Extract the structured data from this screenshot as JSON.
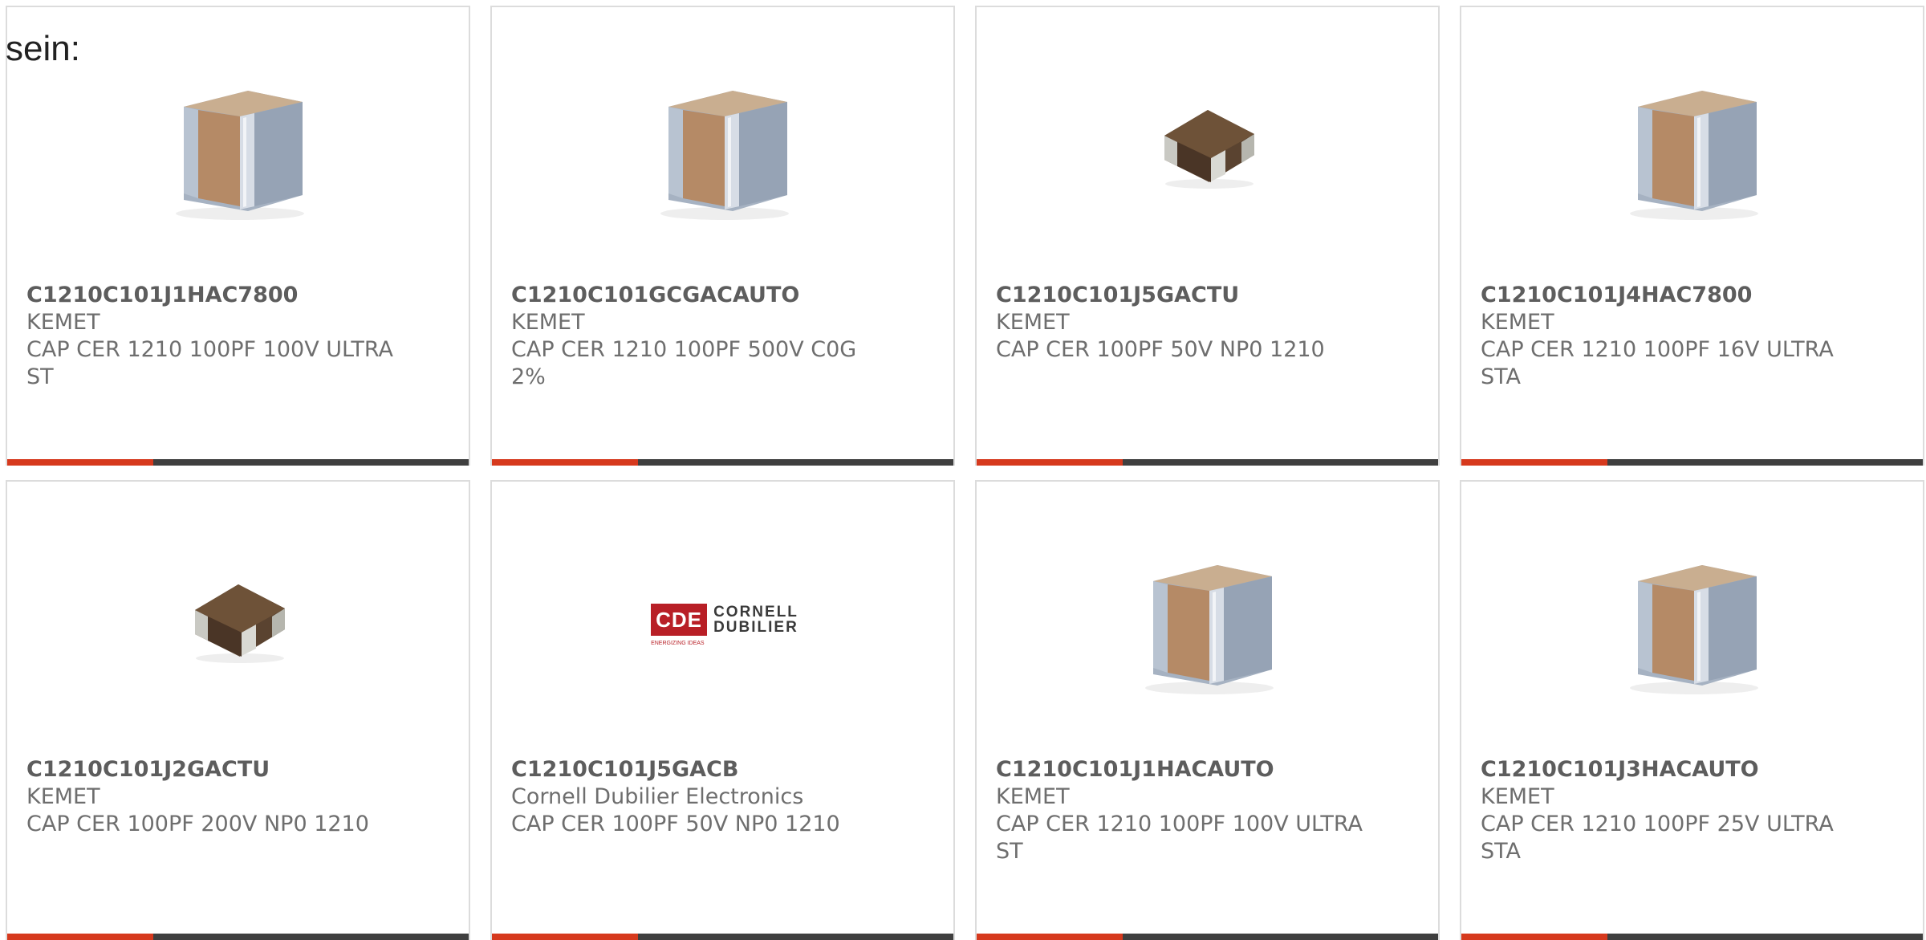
{
  "page": {
    "heading": "sein:"
  },
  "colors": {
    "accent_bar": "#d6391d",
    "dark_bar": "#3f3f3f",
    "card_border": "#dcdcdc",
    "body_text": "#6e6e6e",
    "ceramic": "#b58a66",
    "terminal": "#a6b2c2",
    "logo_red": "#b81f26"
  },
  "products": [
    {
      "part_number": "C1210C101J1HAC7800",
      "manufacturer": "KEMET",
      "description": "CAP CER 1210 100PF 100V ULTRA ST",
      "image": "mlcc-capacitor-large-icon"
    },
    {
      "part_number": "C1210C101GCGACAUTO",
      "manufacturer": "KEMET",
      "description": "CAP CER 1210 100PF 500V C0G 2%",
      "image": "mlcc-capacitor-large-icon"
    },
    {
      "part_number": "C1210C101J5GACTU",
      "manufacturer": "KEMET",
      "description": "CAP CER 100PF 50V NP0 1210",
      "image": "mlcc-capacitor-small-icon"
    },
    {
      "part_number": "C1210C101J4HAC7800",
      "manufacturer": "KEMET",
      "description": "CAP CER 1210 100PF 16V ULTRA STA",
      "image": "mlcc-capacitor-large-icon"
    },
    {
      "part_number": "C1210C101J2GACTU",
      "manufacturer": "KEMET",
      "description": "CAP CER 100PF 200V NP0 1210",
      "image": "mlcc-capacitor-small-icon"
    },
    {
      "part_number": "C1210C101J5GACB",
      "manufacturer": "Cornell Dubilier Electronics",
      "description": "CAP CER 100PF 50V NP0 1210",
      "image": "cde-logo",
      "logo_box_text": "CDE",
      "logo_line1": "CORNELL",
      "logo_line2": "DUBILIER",
      "logo_tag": "ENERGIZING IDEAS"
    },
    {
      "part_number": "C1210C101J1HACAUTO",
      "manufacturer": "KEMET",
      "description": "CAP CER 1210 100PF 100V ULTRA ST",
      "image": "mlcc-capacitor-large-icon"
    },
    {
      "part_number": "C1210C101J3HACAUTO",
      "manufacturer": "KEMET",
      "description": "CAP CER 1210 100PF 25V ULTRA STA",
      "image": "mlcc-capacitor-large-icon"
    }
  ]
}
